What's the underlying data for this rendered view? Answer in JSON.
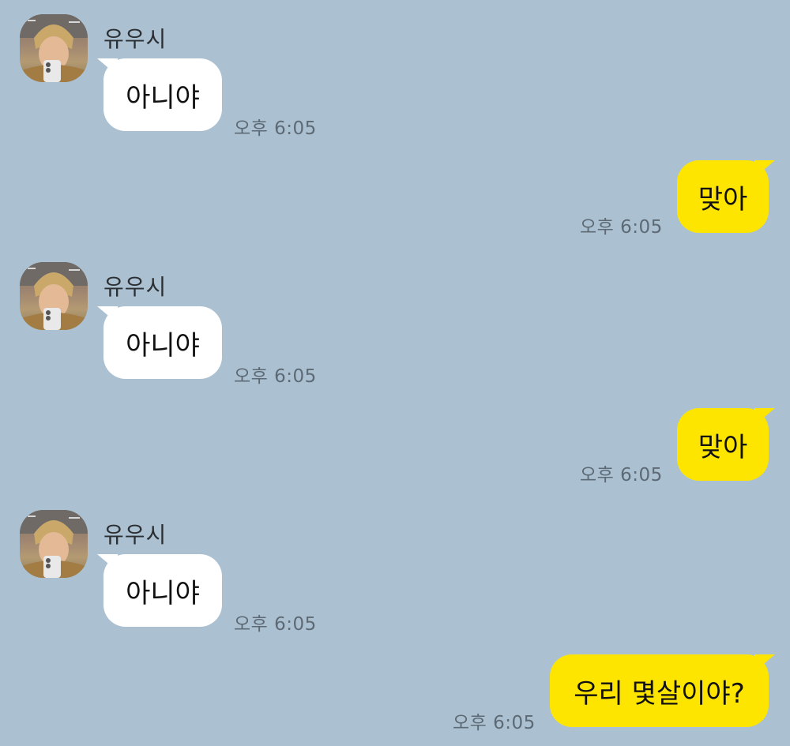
{
  "conversation": {
    "messages": [
      {
        "direction": "in",
        "sender": "유우시",
        "text": "아니야",
        "time": "오후 6:05"
      },
      {
        "direction": "out",
        "text": "맞아",
        "time": "오후 6:05"
      },
      {
        "direction": "in",
        "sender": "유우시",
        "text": "아니야",
        "time": "오후 6:05"
      },
      {
        "direction": "out",
        "text": "맞아",
        "time": "오후 6:05"
      },
      {
        "direction": "in",
        "sender": "유우시",
        "text": "아니야",
        "time": "오후 6:05"
      },
      {
        "direction": "out",
        "text": "우리 몇살이야?",
        "time": "오후 6:05"
      }
    ]
  },
  "colors": {
    "background": "#abc1d1",
    "incoming_bubble": "#ffffff",
    "outgoing_bubble": "#fee500",
    "timestamp": "#5d6a75"
  },
  "icons": {
    "avatar": "profile-photo-icon"
  }
}
